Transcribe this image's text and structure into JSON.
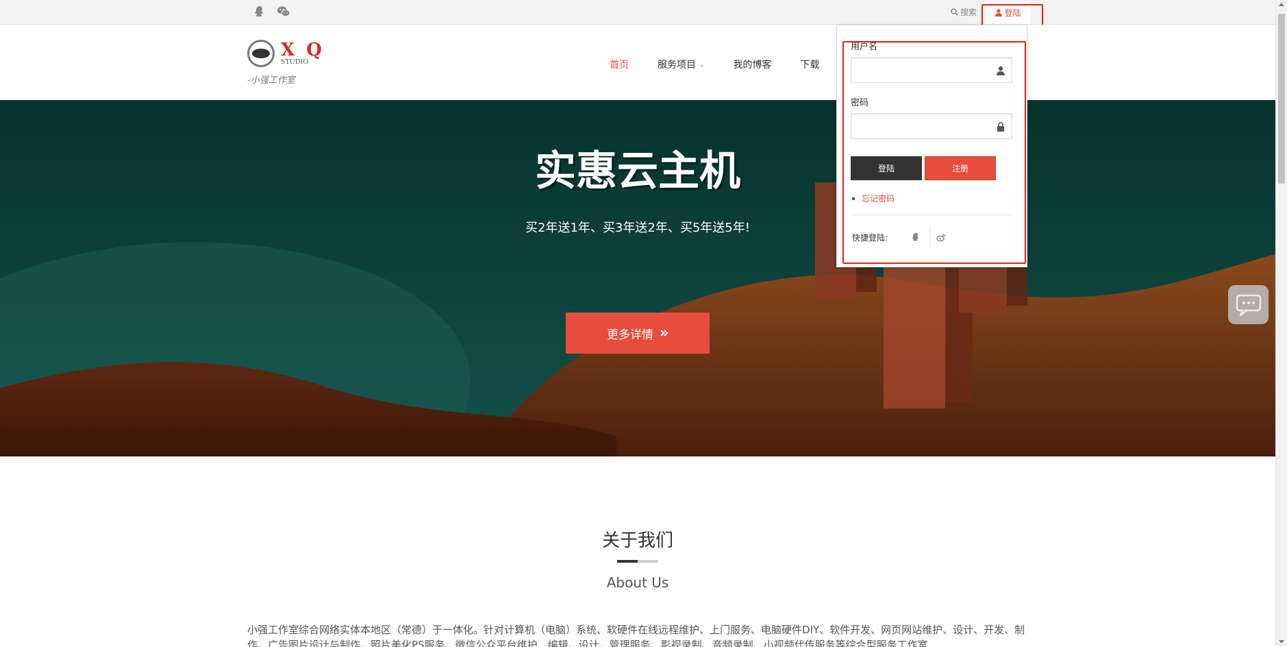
{
  "topbar": {
    "search_label": "搜索",
    "login_label": "登陆"
  },
  "logo": {
    "letters": "X Q",
    "studio": "STUDIO",
    "tagline": "-小强工作室"
  },
  "nav": {
    "items": [
      {
        "label": "首页",
        "active": true
      },
      {
        "label": "服务项目",
        "has_dropdown": true
      },
      {
        "label": "我的博客"
      },
      {
        "label": "下载"
      }
    ]
  },
  "hero": {
    "title": "实惠云主机",
    "subtitle": "买2年送1年、买3年送2年、买5年送5年!",
    "button_label": "更多详情",
    "button_icon": "double-chevron-right-icon"
  },
  "login_panel": {
    "username_label": "用户名",
    "username_value": "",
    "password_label": "密码",
    "password_value": "",
    "login_button": "登陆",
    "register_button": "注册",
    "forgot_link": "忘记密码",
    "quick_login_label": "快捷登陆:",
    "quick_icons": [
      "qq-icon",
      "weibo-icon"
    ]
  },
  "about": {
    "title": "关于我们",
    "subtitle": "About Us",
    "text": "小强工作室综合网络实体本地区（常德）于一体化。针对计算机（电脑）系统、软硬件在线远程维护、上门服务、电脑硬件DIY、软件开发、网页网站维护、设计、开发、制作、广告图片设计与制作、照片美化PS服务、微信公众平台维护、编辑、设计、管理服务、影视录制、音频录制、小视频代传服务等综合型服务工作室"
  },
  "colors": {
    "accent": "#e84c3d",
    "hero_bg": "#0c3d38",
    "highlight": "#e0201a"
  }
}
